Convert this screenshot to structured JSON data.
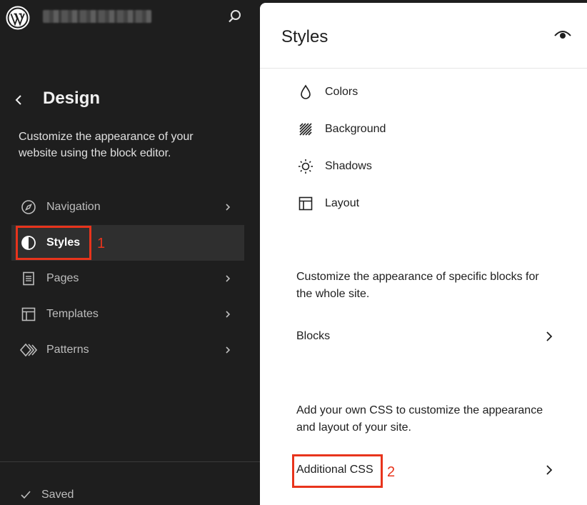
{
  "sidebar": {
    "title": "Design",
    "description": "Customize the appearance of your website using the block editor.",
    "items": [
      {
        "label": "Navigation",
        "icon": "navigation-icon",
        "has_chevron": true
      },
      {
        "label": "Styles",
        "icon": "styles-icon",
        "active": true
      },
      {
        "label": "Pages",
        "icon": "pages-icon",
        "has_chevron": true
      },
      {
        "label": "Templates",
        "icon": "templates-icon",
        "has_chevron": true
      },
      {
        "label": "Patterns",
        "icon": "patterns-icon",
        "has_chevron": true
      }
    ],
    "status": "Saved"
  },
  "panel": {
    "title": "Styles",
    "style_items": [
      {
        "label": "Colors",
        "icon": "droplet-icon"
      },
      {
        "label": "Background",
        "icon": "background-icon"
      },
      {
        "label": "Shadows",
        "icon": "shadow-icon"
      },
      {
        "label": "Layout",
        "icon": "layout-icon"
      }
    ],
    "blocks_description": "Customize the appearance of specific blocks for the whole site.",
    "blocks_label": "Blocks",
    "css_description": "Add your own CSS to customize the appearance and layout of your site.",
    "css_label": "Additional CSS"
  },
  "annotations": {
    "step1": "1",
    "step2": "2"
  },
  "colors": {
    "sidebar_bg": "#1e1e1e",
    "highlight": "#e8341c",
    "panel_bg": "#ffffff"
  }
}
